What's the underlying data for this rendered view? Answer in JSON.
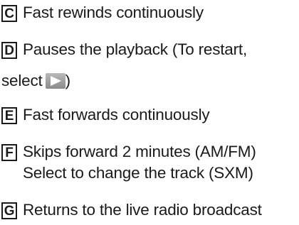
{
  "items": [
    {
      "key": "C",
      "lines": [
        "Fast rewinds continuously"
      ]
    },
    {
      "key": "D",
      "lines": [
        "Pauses the playback (To restart,",
        "select",
        ")"
      ]
    },
    {
      "key": "E",
      "lines": [
        "Fast forwards continuously"
      ]
    },
    {
      "key": "F",
      "lines": [
        "Skips forward 2 minutes (AM/FM)",
        "Select to change the track (SXM)"
      ]
    },
    {
      "key": "G",
      "lines": [
        "Returns to the live radio broadcast"
      ]
    }
  ],
  "icons": {
    "play": "play-button-icon"
  }
}
